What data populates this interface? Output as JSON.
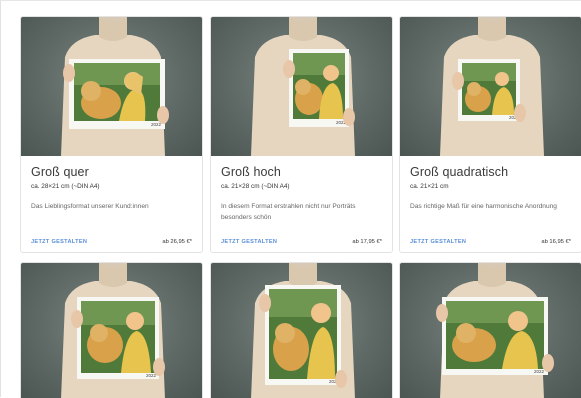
{
  "cards": [
    {
      "title": "Groß quer",
      "size": "ca. 28×21 cm (~DIN A4)",
      "desc": "Das Lieblingsformat unserer Kund:innen",
      "cta": "JETZT GESTALTEN",
      "price": "ab 26,95 €*",
      "print_number": "2022"
    },
    {
      "title": "Groß hoch",
      "size": "ca. 21×28 cm (~DIN A4)",
      "desc": "In diesem Format erstrahlen nicht nur Porträts besonders schön",
      "cta": "JETZT GESTALTEN",
      "price": "ab 17,95 €*",
      "print_number": "2022"
    },
    {
      "title": "Groß quadratisch",
      "size": "ca. 21×21 cm",
      "desc": "Das richtige Maß für eine harmonische Anordnung",
      "cta": "JETZT GESTALTEN",
      "price": "ab 16,95 €*",
      "print_number": "2022"
    }
  ],
  "bottom_cards": [
    {
      "print_number": "2022"
    },
    {
      "print_number": "2022"
    },
    {
      "print_number": "2022"
    }
  ],
  "colors": {
    "cta": "#5a8fd8",
    "photo_bg": "#5f6a66",
    "sweater": "#e6d6c0",
    "dog": "#d9a24a",
    "foliage": "#4f7a3a"
  }
}
